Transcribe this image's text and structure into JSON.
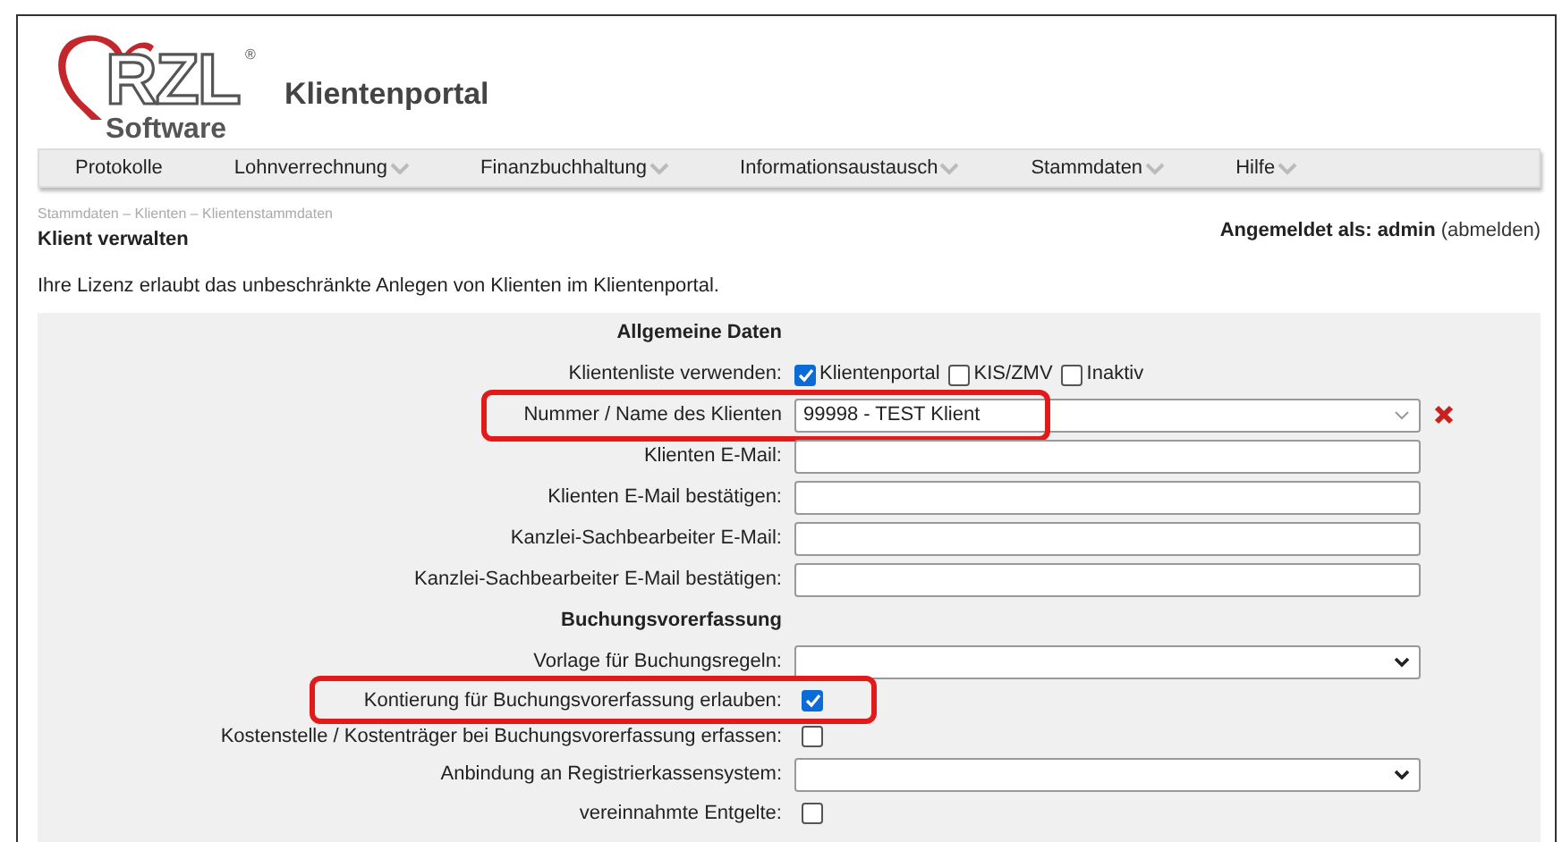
{
  "logo": {
    "wordmark": "RZL",
    "registered": "®",
    "subline": "Software"
  },
  "app_title": "Klientenportal",
  "nav": [
    {
      "label": "Protokolle",
      "has_menu": false
    },
    {
      "label": "Lohnverrechnung",
      "has_menu": true
    },
    {
      "label": "Finanzbuchhaltung",
      "has_menu": true
    },
    {
      "label": "Informationsaustausch",
      "has_menu": true
    },
    {
      "label": "Stammdaten",
      "has_menu": true
    },
    {
      "label": "Hilfe",
      "has_menu": true
    }
  ],
  "breadcrumb": "Stammdaten – Klienten – Klientenstammdaten",
  "login": {
    "prefix": "Angemeldet als:",
    "user": "admin",
    "logout": "(abmelden)"
  },
  "page_title": "Klient verwalten",
  "license_note": "Ihre Lizenz erlaubt das unbeschränkte Anlegen von Klienten im Klientenportal.",
  "form": [
    {
      "kind": "heading",
      "label": "Allgemeine Daten"
    },
    {
      "kind": "checkgroup",
      "label": "Klientenliste verwenden:",
      "options": [
        {
          "label": "Klientenportal",
          "checked": true
        },
        {
          "label": "KIS/ZMV",
          "checked": false
        },
        {
          "label": "Inaktiv",
          "checked": false
        }
      ]
    },
    {
      "kind": "combo",
      "label": "Nummer / Name des Klienten",
      "value": "99998 - TEST Klient",
      "clearable": true,
      "highlighted": true
    },
    {
      "kind": "text",
      "label": "Klienten E-Mail:",
      "highlighted": false
    },
    {
      "kind": "text",
      "label": "Klienten E-Mail bestätigen:",
      "highlighted": false
    },
    {
      "kind": "text",
      "label": "Kanzlei-Sachbearbeiter E-Mail:",
      "highlighted": false
    },
    {
      "kind": "text",
      "label": "Kanzlei-Sachbearbeiter E-Mail bestätigen:",
      "highlighted": false
    },
    {
      "kind": "heading",
      "label": "Buchungsvorerfassung"
    },
    {
      "kind": "select",
      "label": "Vorlage für Buchungsregeln:",
      "highlighted": false
    },
    {
      "kind": "checkbox",
      "label": "Kontierung für Buchungsvorerfassung erlauben:",
      "checked": true,
      "highlighted": true
    },
    {
      "kind": "checkbox",
      "label": "Kostenstelle / Kostenträger bei Buchungsvorerfassung erfassen:",
      "checked": false,
      "highlighted": false
    },
    {
      "kind": "select",
      "label": "Anbindung an Registrierkassensystem:",
      "highlighted": false
    },
    {
      "kind": "checkbox",
      "label": "vereinnahmte Entgelte:",
      "checked": false,
      "highlighted": false
    }
  ]
}
